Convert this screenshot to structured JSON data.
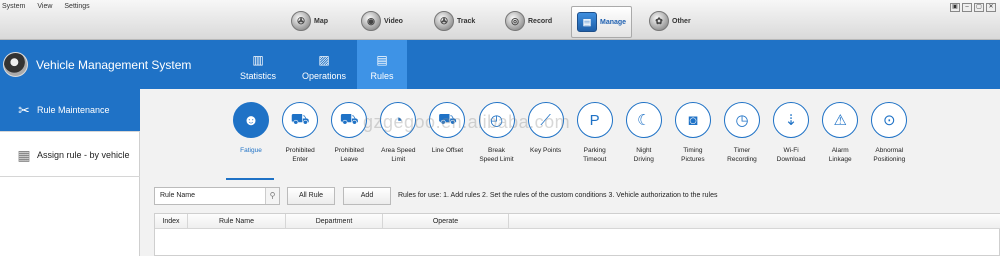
{
  "menu": [
    "System",
    "View",
    "Settings"
  ],
  "nav": [
    {
      "label": "Map",
      "icon": "map-icon",
      "glyph": "✇"
    },
    {
      "label": "Video",
      "icon": "video-icon",
      "glyph": "◉"
    },
    {
      "label": "Track",
      "icon": "track-icon",
      "glyph": "✇"
    },
    {
      "label": "Record",
      "icon": "record-icon",
      "glyph": "◎"
    },
    {
      "label": "Manage",
      "icon": "manage-icon",
      "glyph": "▤"
    },
    {
      "label": "Other",
      "icon": "other-icon",
      "glyph": "✿"
    }
  ],
  "window_controls": [
    "▣",
    "–",
    "▢",
    "✕"
  ],
  "app": {
    "title": "Vehicle Management System"
  },
  "tabs": [
    {
      "label": "Statistics",
      "icon": "bar-chart-icon",
      "glyph": "▥"
    },
    {
      "label": "Operations",
      "icon": "operations-icon",
      "glyph": "▨"
    },
    {
      "label": "Rules",
      "icon": "rules-icon",
      "glyph": "▤"
    }
  ],
  "sidebar": {
    "items": [
      {
        "label": "Rule Maintenance",
        "icon": "tools-icon",
        "glyph": "✂"
      },
      {
        "label": "Assign rule - by vehicle",
        "icon": "vehicle-assign-icon",
        "glyph": "▦"
      }
    ]
  },
  "rules": [
    {
      "line1": "Fatigue",
      "line2": "",
      "icon": "fatigue-icon",
      "glyph": "☻"
    },
    {
      "line1": "Prohibited",
      "line2": "Enter",
      "icon": "prohibited-enter-icon",
      "glyph": "⛟"
    },
    {
      "line1": "Prohibited",
      "line2": "Leave",
      "icon": "prohibited-leave-icon",
      "glyph": "⛟"
    },
    {
      "line1": "Area Speed",
      "line2": "Limit",
      "icon": "area-speed-icon",
      "glyph": "◔"
    },
    {
      "line1": "Line Offset",
      "line2": "",
      "icon": "line-offset-icon",
      "glyph": "⛟"
    },
    {
      "line1": "Break",
      "line2": "Speed Limit",
      "icon": "speed-limit-icon",
      "glyph": "◴"
    },
    {
      "line1": "Key Points",
      "line2": "",
      "icon": "key-points-icon",
      "glyph": "⟋"
    },
    {
      "line1": "Parking",
      "line2": "Timeout",
      "icon": "parking-timeout-icon",
      "glyph": "P"
    },
    {
      "line1": "Night",
      "line2": "Driving",
      "icon": "night-driving-icon",
      "glyph": "☾"
    },
    {
      "line1": "Timing",
      "line2": "Pictures",
      "icon": "camera-icon",
      "glyph": "◙"
    },
    {
      "line1": "Timer",
      "line2": "Recording",
      "icon": "timer-icon",
      "glyph": "◷"
    },
    {
      "line1": "Wi-Fi",
      "line2": "Download",
      "icon": "wifi-download-icon",
      "glyph": "⇣"
    },
    {
      "line1": "Alarm",
      "line2": "Linkage",
      "icon": "alarm-icon",
      "glyph": "⚠"
    },
    {
      "line1": "Abnormal",
      "line2": "Positioning",
      "icon": "abnormal-position-icon",
      "glyph": "⊙"
    }
  ],
  "watermark": "gzgegoo.en.alibaba.com",
  "controls": {
    "search_value": "Rule Name",
    "search_glyph": "⚲",
    "all_rule": "All Rule",
    "add": "Add",
    "info": "Rules for use: 1. Add rules 2. Set the rules of the custom conditions 3. Vehicle authorization to the rules"
  },
  "table": {
    "columns": [
      "Index",
      "Rule Name",
      "Department",
      "Operate"
    ]
  },
  "colors": {
    "accent": "#1f72c6",
    "accent_light": "#3e93e6"
  }
}
